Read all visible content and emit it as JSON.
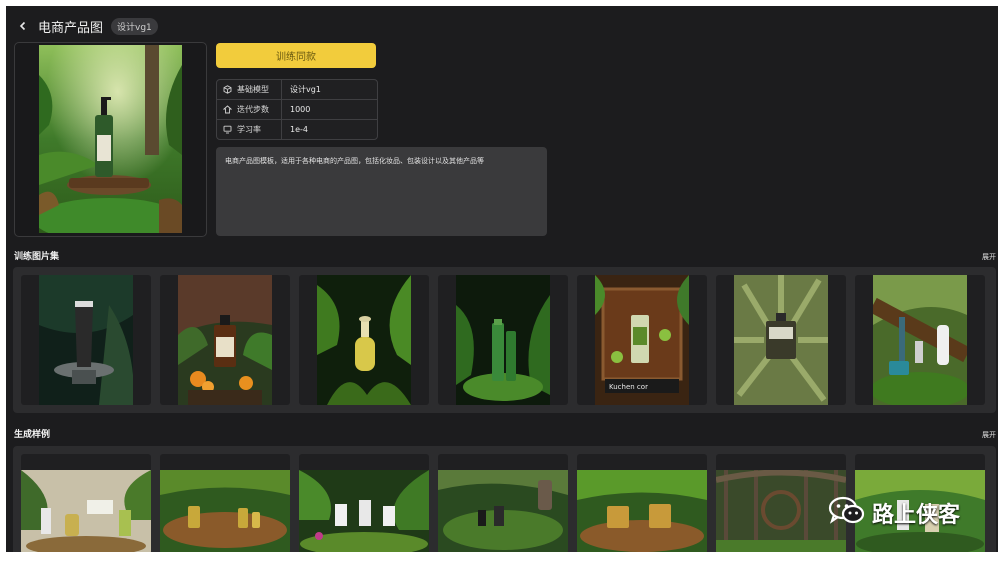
{
  "header": {
    "title": "电商产品图",
    "badge": "设计vg1"
  },
  "train_button": "训练同款",
  "params": [
    {
      "icon": "cube-icon",
      "label": "基础模型",
      "value": "设计vg1"
    },
    {
      "icon": "steps-icon",
      "label": "迭代步数",
      "value": "1000"
    },
    {
      "icon": "monitor-icon",
      "label": "学习率",
      "value": "1e-4"
    }
  ],
  "description": "电商产品图模板，适用于各种电商的产品图，包括化妆品、包装设计以及其他产品等",
  "training_section": {
    "title": "训练图片集",
    "expand": "展开",
    "images": [
      "dark-tube-product-photo",
      "amber-bottle-with-oranges-photo",
      "yellow-dropper-bottle-ferns-photo",
      "green-bottle-ferns-photo",
      "wooden-box-kiwi-photo",
      "perfume-bottle-leaves-photo",
      "cosmetics-moss-log-photo"
    ]
  },
  "generated_section": {
    "title": "生成样例",
    "expand": "展开",
    "images": [
      "generated-sample-1",
      "generated-sample-2",
      "generated-sample-3",
      "generated-sample-4",
      "generated-sample-5",
      "generated-sample-6",
      "generated-sample-7"
    ]
  },
  "watermark": "路上侠客",
  "colors": {
    "background": "#1c1c1e",
    "accent": "#f2cc3c",
    "panel": "#2c2c2e"
  }
}
